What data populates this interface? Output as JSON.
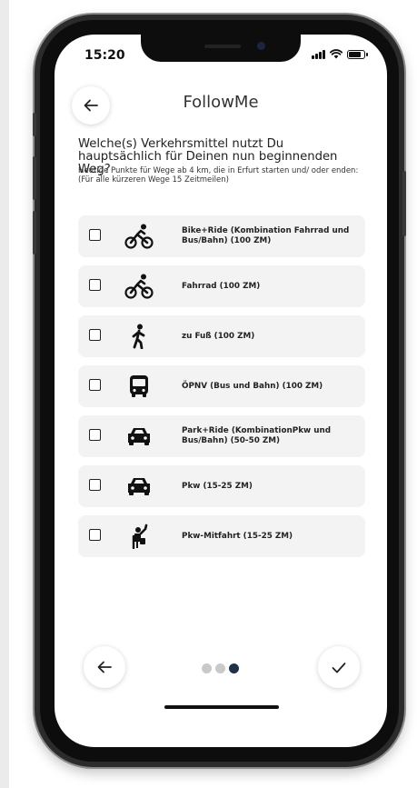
{
  "status_bar": {
    "time": "15:20"
  },
  "header": {
    "title": "FollowMe"
  },
  "question": "Welche(s) Verkehrsmittel nutzt Du hauptsächlich für Deinen nun beginnenden Weg?",
  "note": "Heutige Punkte für Wege ab 4 km, die in Erfurt starten und/ oder enden: (Für alle kürzeren Wege 15 Zeitmeilen)",
  "options": [
    {
      "icon": "bike-rider-icon",
      "label": "Bike+Ride (Kombination Fahrrad und Bus/Bahn) (100 ZM)",
      "checked": false
    },
    {
      "icon": "bike-rider-icon",
      "label": "Fahrrad (100 ZM)",
      "checked": false
    },
    {
      "icon": "walking-person-icon",
      "label": "zu Fuß (100 ZM)",
      "checked": false
    },
    {
      "icon": "bus-icon",
      "label": "ÖPNV (Bus und Bahn) (100 ZM)",
      "checked": false
    },
    {
      "icon": "car-icon",
      "label": "Park+Ride (KombinationPkw und Bus/Bahn) (50-50 ZM)",
      "checked": false
    },
    {
      "icon": "car-icon",
      "label": "Pkw (15-25 ZM)",
      "checked": false
    },
    {
      "icon": "hitchhiker-icon",
      "label": "Pkw-Mitfahrt (15-25 ZM)",
      "checked": false
    }
  ],
  "pagination": {
    "total": 3,
    "current": 3
  },
  "colors": {
    "accent": "#1f3144",
    "card": "#f3f3f3",
    "dot_inactive": "#c9c9c9"
  }
}
